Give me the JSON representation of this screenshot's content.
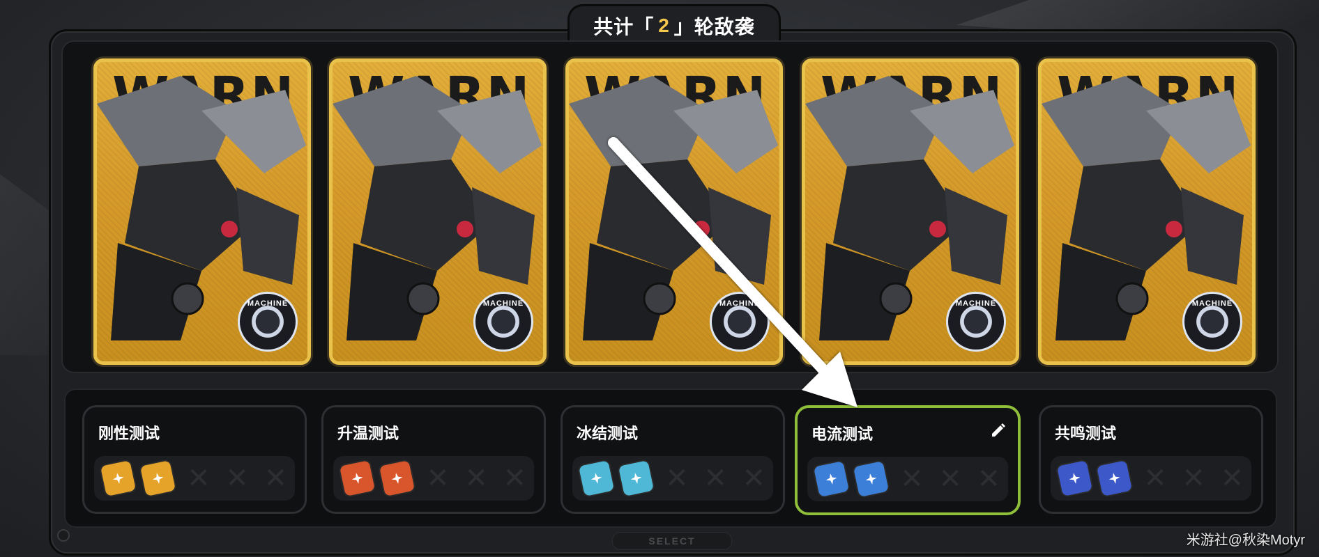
{
  "header": {
    "prefix": "共计「",
    "count": "2",
    "suffix": "」轮敌袭"
  },
  "cards": [
    {
      "warning_text": "WARN",
      "badge_text": "MACHINE"
    },
    {
      "warning_text": "WARN",
      "badge_text": "MACHINE"
    },
    {
      "warning_text": "WARN",
      "badge_text": "MACHINE"
    },
    {
      "warning_text": "WARN",
      "badge_text": "MACHINE"
    },
    {
      "warning_text": "WARN",
      "badge_text": "MACHINE"
    }
  ],
  "tests": [
    {
      "label": "刚性测试",
      "color": "#e6a32a",
      "active": false
    },
    {
      "label": "升温测试",
      "color": "#d9562c",
      "active": false
    },
    {
      "label": "冰结测试",
      "color": "#4fb8d6",
      "active": false
    },
    {
      "label": "电流测试",
      "color": "#3c7fd9",
      "active": true
    },
    {
      "label": "共鸣测试",
      "color": "#3d58c9",
      "active": false
    }
  ],
  "footer": {
    "select_label": "SELECT"
  },
  "watermark": "米游社@秋染Motyr",
  "accent_color": "#8fbf3a"
}
